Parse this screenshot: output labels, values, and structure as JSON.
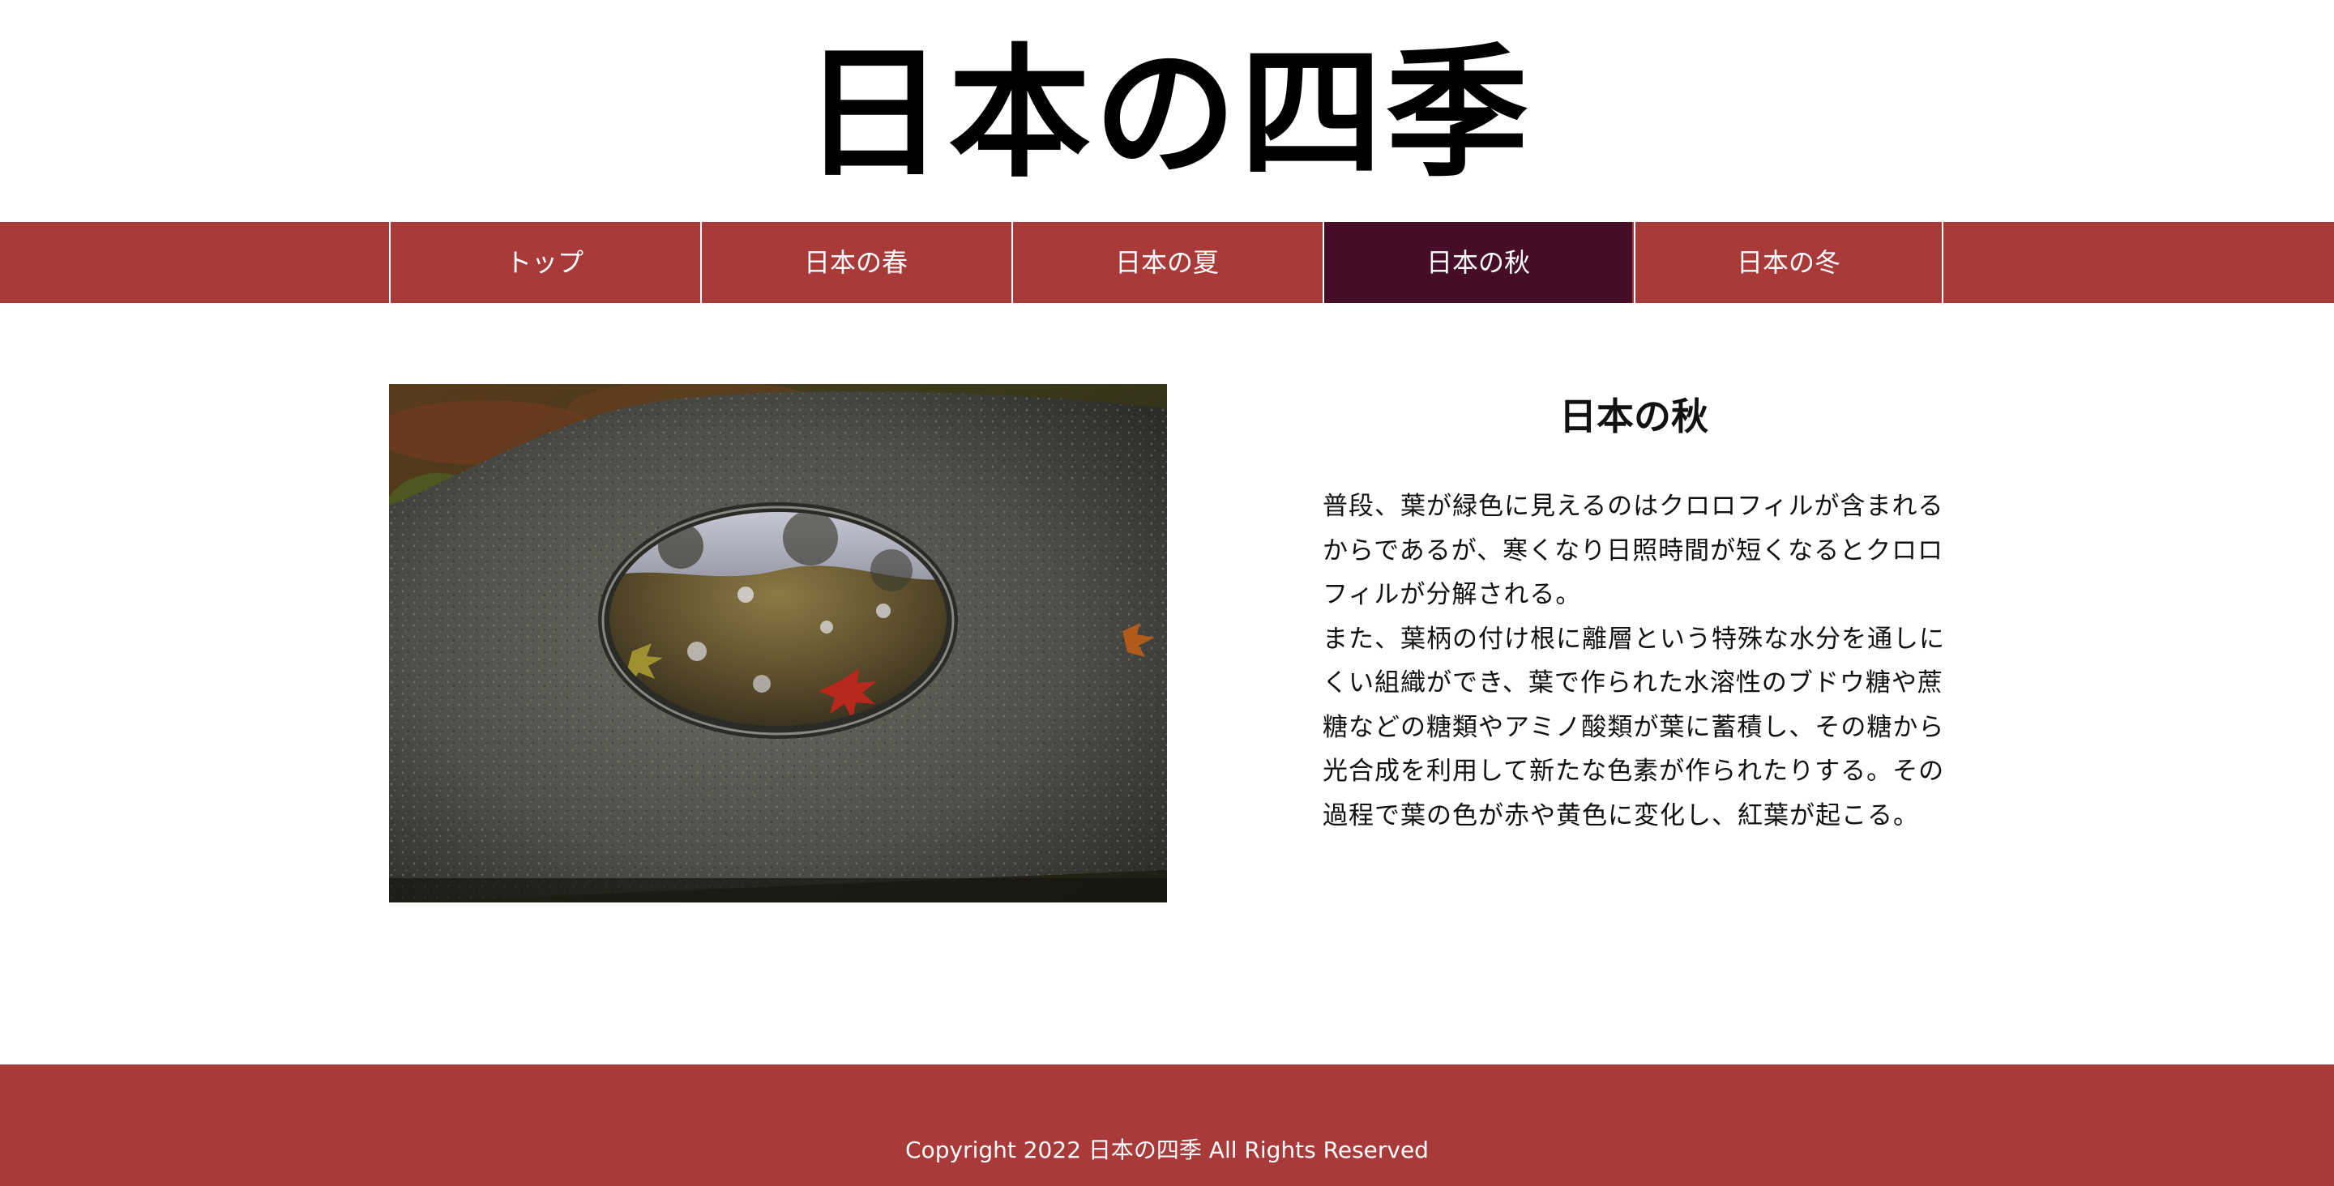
{
  "header": {
    "site_title": "日本の四季"
  },
  "nav": {
    "items": [
      {
        "label": "トップ"
      },
      {
        "label": "日本の春"
      },
      {
        "label": "日本の夏"
      },
      {
        "label": "日本の秋",
        "active": true
      },
      {
        "label": "日本の冬"
      }
    ]
  },
  "article": {
    "title": "日本の秋",
    "image_alt": "stone-water-basin-with-red-maple-leaf",
    "paragraphs": [
      "普段、葉が緑色に見えるのはクロロフィルが含まれるからであるが、寒くなり日照時間が短くなるとクロロフィルが分解される。",
      "また、葉柄の付け根に離層という特殊な水分を通しにくい組織ができ、葉で作られた水溶性のブドウ糖や蔗糖などの糖類やアミノ酸類が葉に蓄積し、その糖から光合成を利用して新たな色素が作られたりする。その過程で葉の色が赤や黄色に変化し、紅葉が起こる。"
    ]
  },
  "footer": {
    "copyright": "Copyright 2022 日本の四季 All Rights Reserved"
  },
  "colors": {
    "nav_bg": "#a83a3a",
    "nav_active": "#450d28",
    "footer_bg": "#a83a3a",
    "text": "#111111"
  }
}
